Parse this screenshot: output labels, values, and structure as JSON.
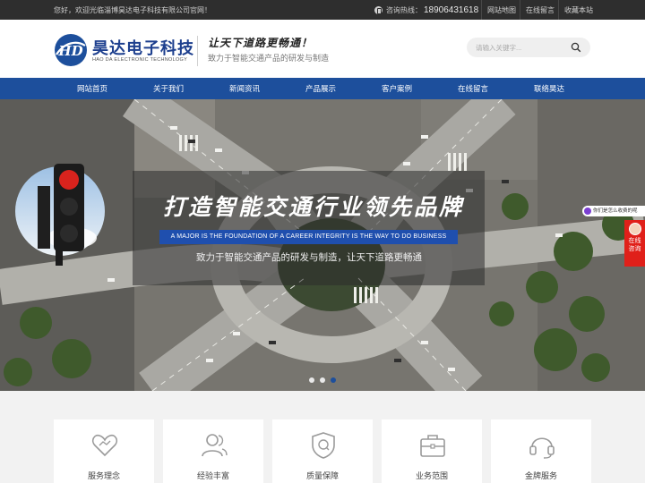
{
  "topbar": {
    "welcome": "您好，欢迎光临淄博昊达电子科技有限公司官网！",
    "hotline_label": "咨询热线：",
    "hotline_number": "18906431618",
    "links": [
      "网站地图",
      "在线留言",
      "收藏本站"
    ]
  },
  "header": {
    "logo_mark": "HD",
    "logo_cn": "昊达电子科技",
    "logo_en": "HAO DA ELECTRONIC TECHNOLOGY",
    "slogan_main": "让天下道路更畅通！",
    "slogan_sub": "致力于智能交通产品的研发与制造",
    "search_placeholder": "请输入关键字..."
  },
  "nav": {
    "items": [
      "网站首页",
      "关于我们",
      "新闻资讯",
      "产品展示",
      "客户案例",
      "在线留言",
      "联络昊达"
    ]
  },
  "banner": {
    "title": "打造智能交通行业领先品牌",
    "strip": "A MAJOR IS THE FOUNDATION OF A CAREER INTEGRITY IS THE WAY TO DO BUSINESS",
    "subtitle": "致力于智能交通产品的研发与制造，让天下道路更畅通",
    "active_slide": 3,
    "slide_count": 3
  },
  "widgets": {
    "fee_tab": "你们是怎么收费的呢",
    "online_consult": [
      "在线",
      "咨询"
    ]
  },
  "features": {
    "items": [
      {
        "label": "服务理念",
        "icon": "heart-icon"
      },
      {
        "label": "经验丰富",
        "icon": "users-icon"
      },
      {
        "label": "质量保障",
        "icon": "shield-check-icon"
      },
      {
        "label": "业务范围",
        "icon": "briefcase-icon"
      },
      {
        "label": "金牌服务",
        "icon": "headset-icon"
      }
    ]
  },
  "colors": {
    "brand_blue": "#1d4f9c",
    "topbar": "#2e2e2e",
    "accent_red": "#e0201a"
  }
}
